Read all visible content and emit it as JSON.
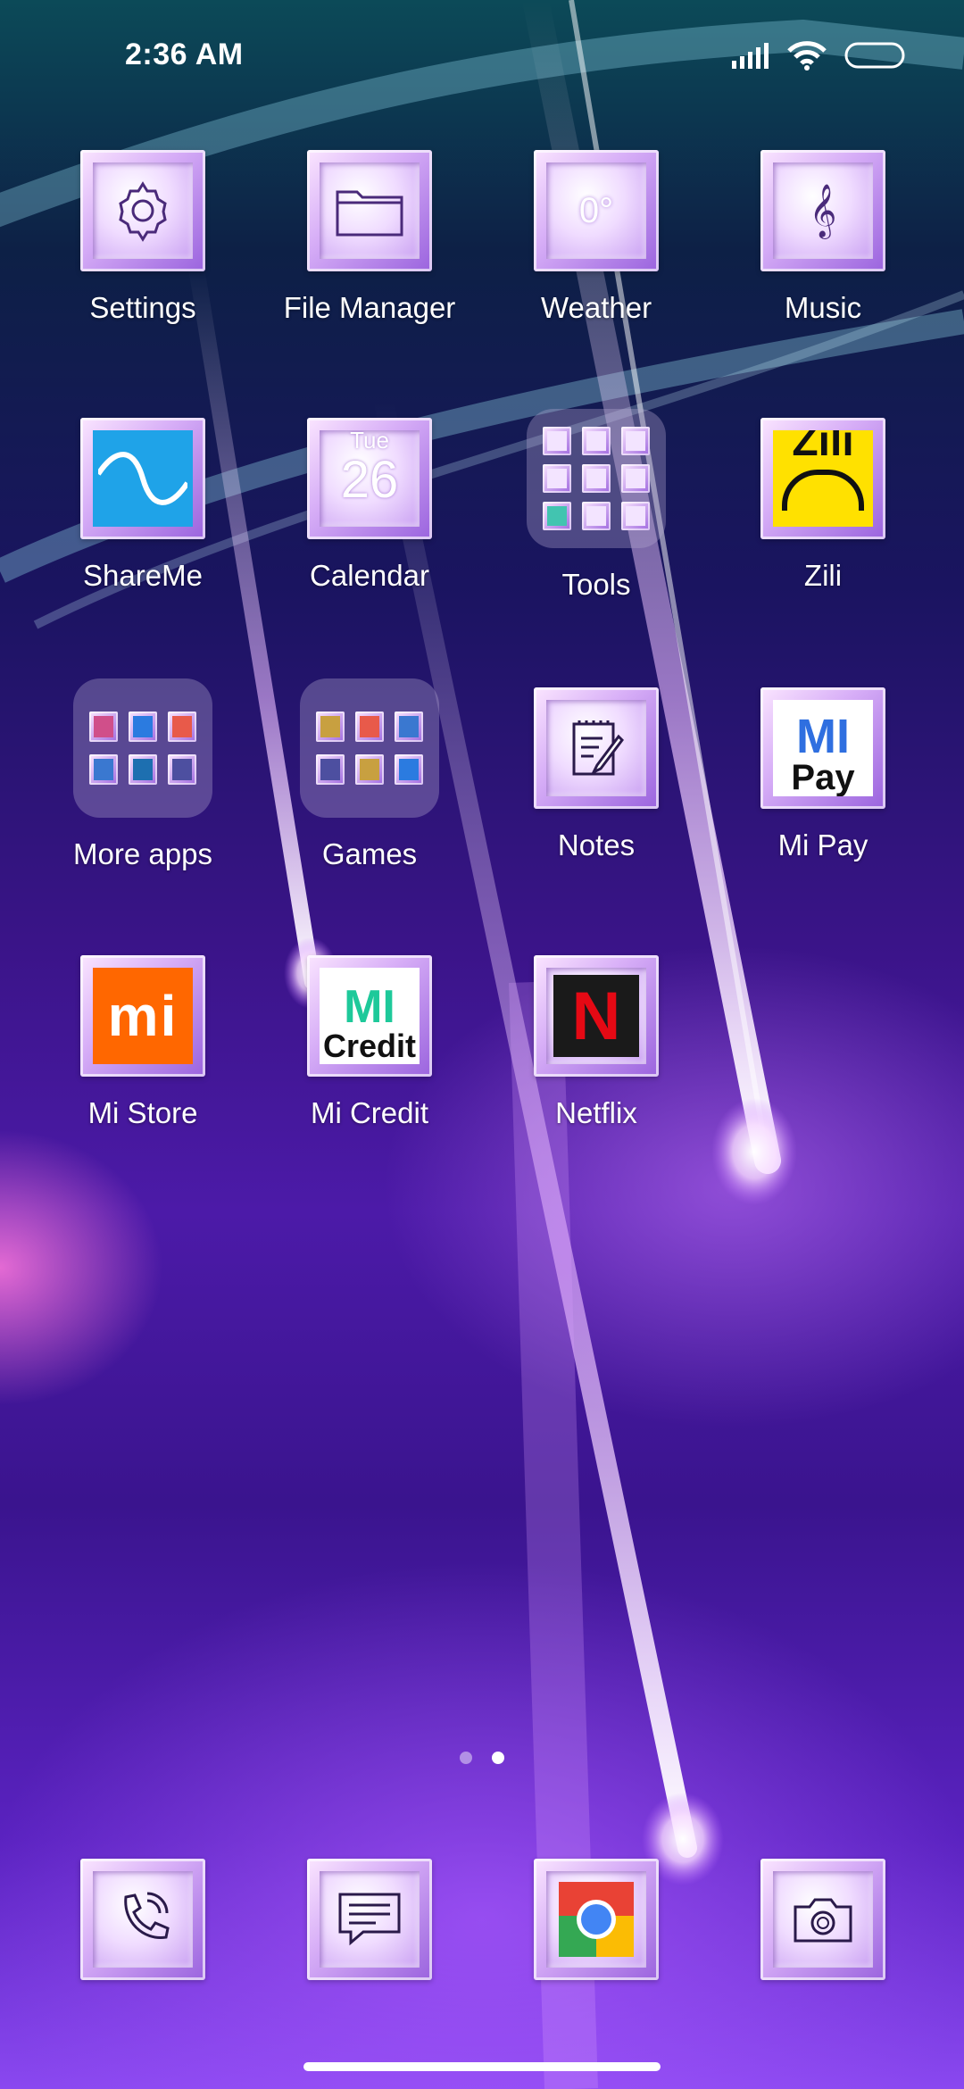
{
  "status_bar": {
    "time": "2:36 AM",
    "icons": [
      "signal-icon",
      "wifi-icon",
      "battery-icon"
    ]
  },
  "apps": [
    {
      "label": "Settings",
      "icon": "gear-icon"
    },
    {
      "label": "File Manager",
      "icon": "folder-icon"
    },
    {
      "label": "Weather",
      "icon": "weather-icon",
      "icon_text": "0°"
    },
    {
      "label": "Music",
      "icon": "treble-clef-icon"
    },
    {
      "label": "ShareMe",
      "icon": "shareme-icon"
    },
    {
      "label": "Calendar",
      "icon": "calendar-icon",
      "day_name": "Tue",
      "day_number": "26"
    },
    {
      "label": "Tools",
      "icon": "folder-icon"
    },
    {
      "label": "Zili",
      "icon": "zili-icon",
      "icon_text": "Zili"
    },
    {
      "label": "More apps",
      "icon": "folder-icon"
    },
    {
      "label": "Games",
      "icon": "folder-icon"
    },
    {
      "label": "Notes",
      "icon": "notepad-icon"
    },
    {
      "label": "Mi Pay",
      "icon": "mi-pay-icon",
      "icon_text_1": "MI",
      "icon_text_2": "Pay"
    },
    {
      "label": "Mi Store",
      "icon": "mi-logo-icon",
      "icon_text": "mi"
    },
    {
      "label": "Mi Credit",
      "icon": "mi-credit-icon",
      "icon_text_1": "MI",
      "icon_text_2": "Credit"
    },
    {
      "label": "Netflix",
      "icon": "netflix-icon",
      "icon_text": "N"
    }
  ],
  "dock": [
    {
      "name": "phone",
      "icon": "phone-icon"
    },
    {
      "name": "messages",
      "icon": "message-icon"
    },
    {
      "name": "chrome",
      "icon": "chrome-icon"
    },
    {
      "name": "camera",
      "icon": "camera-icon"
    }
  ],
  "page_indicator": {
    "pages": 2,
    "current": 2
  },
  "colors": {
    "tile_frame": "#d7aef7",
    "tile_face": "#f0dcff",
    "label_text": "#ffffff",
    "netflix_red": "#e50914",
    "mi_orange": "#ff6700",
    "shareme_blue": "#1fa3e8",
    "zili_yellow": "#ffe100",
    "mi_credit_green": "#1ec99a",
    "mi_pay_blue": "#2f6fe0"
  }
}
